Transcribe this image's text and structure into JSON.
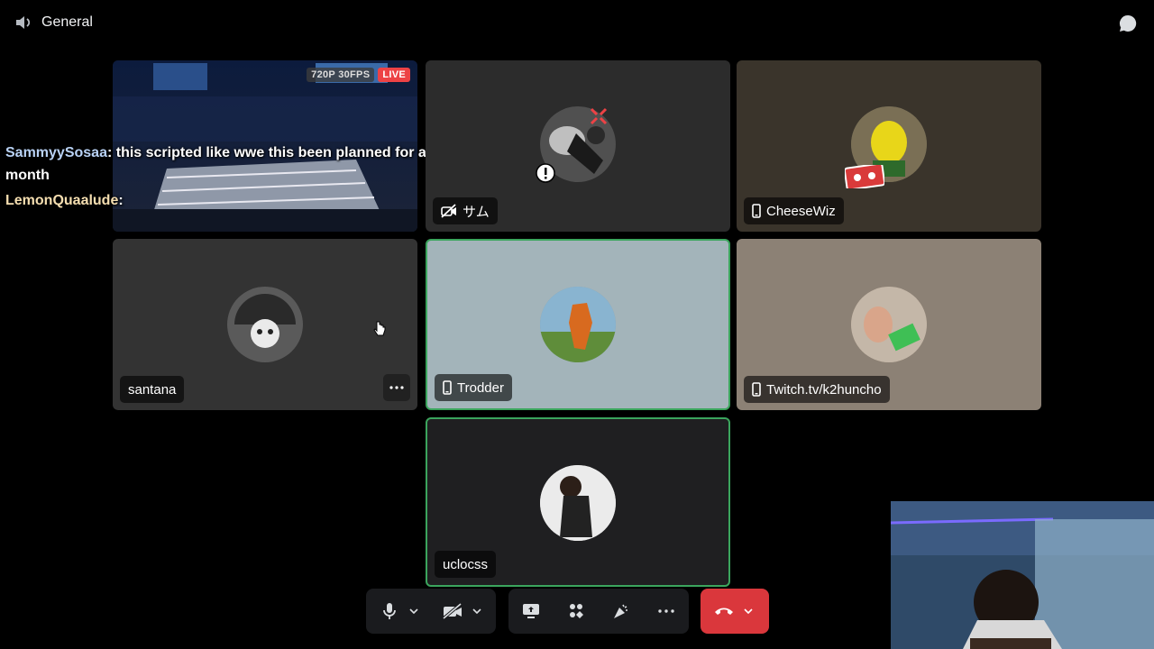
{
  "header": {
    "channel_name": "General",
    "speaker_icon": "speaker-icon",
    "chat_icon": "chat-bubble-icon"
  },
  "stream": {
    "quality_badge": "720P 30FPS",
    "live_badge": "LIVE",
    "chat": [
      {
        "user": "SammyySosaa",
        "message": ": this scripted like wwe this been planned for a month"
      },
      {
        "user": "LemonQuaalude",
        "message": ":"
      }
    ]
  },
  "tiles": {
    "samu": {
      "name": "サム",
      "status_icon": "camera-off-icon"
    },
    "cheesewiz": {
      "name": "CheeseWiz",
      "status_icon": "mobile-phone-icon"
    },
    "santana": {
      "name": "santana",
      "more": "more-options-icon"
    },
    "trodder": {
      "name": "Trodder",
      "status_icon": "mobile-phone-icon"
    },
    "twitch": {
      "name": "Twitch.tv/k2huncho",
      "status_icon": "mobile-phone-icon"
    },
    "uclocss": {
      "name": "uclocss"
    }
  },
  "controls": {
    "mic": "microphone-icon",
    "camera_off": "camera-off-icon",
    "share": "screen-share-icon",
    "activities": "activities-icon",
    "soundboard": "soundboard-icon",
    "more": "more-icon",
    "disconnect": "hang-up-icon",
    "disconnect_color": "#da373c"
  },
  "colors": {
    "speaking_border": "#3ba55d",
    "live": "#ed4245"
  }
}
